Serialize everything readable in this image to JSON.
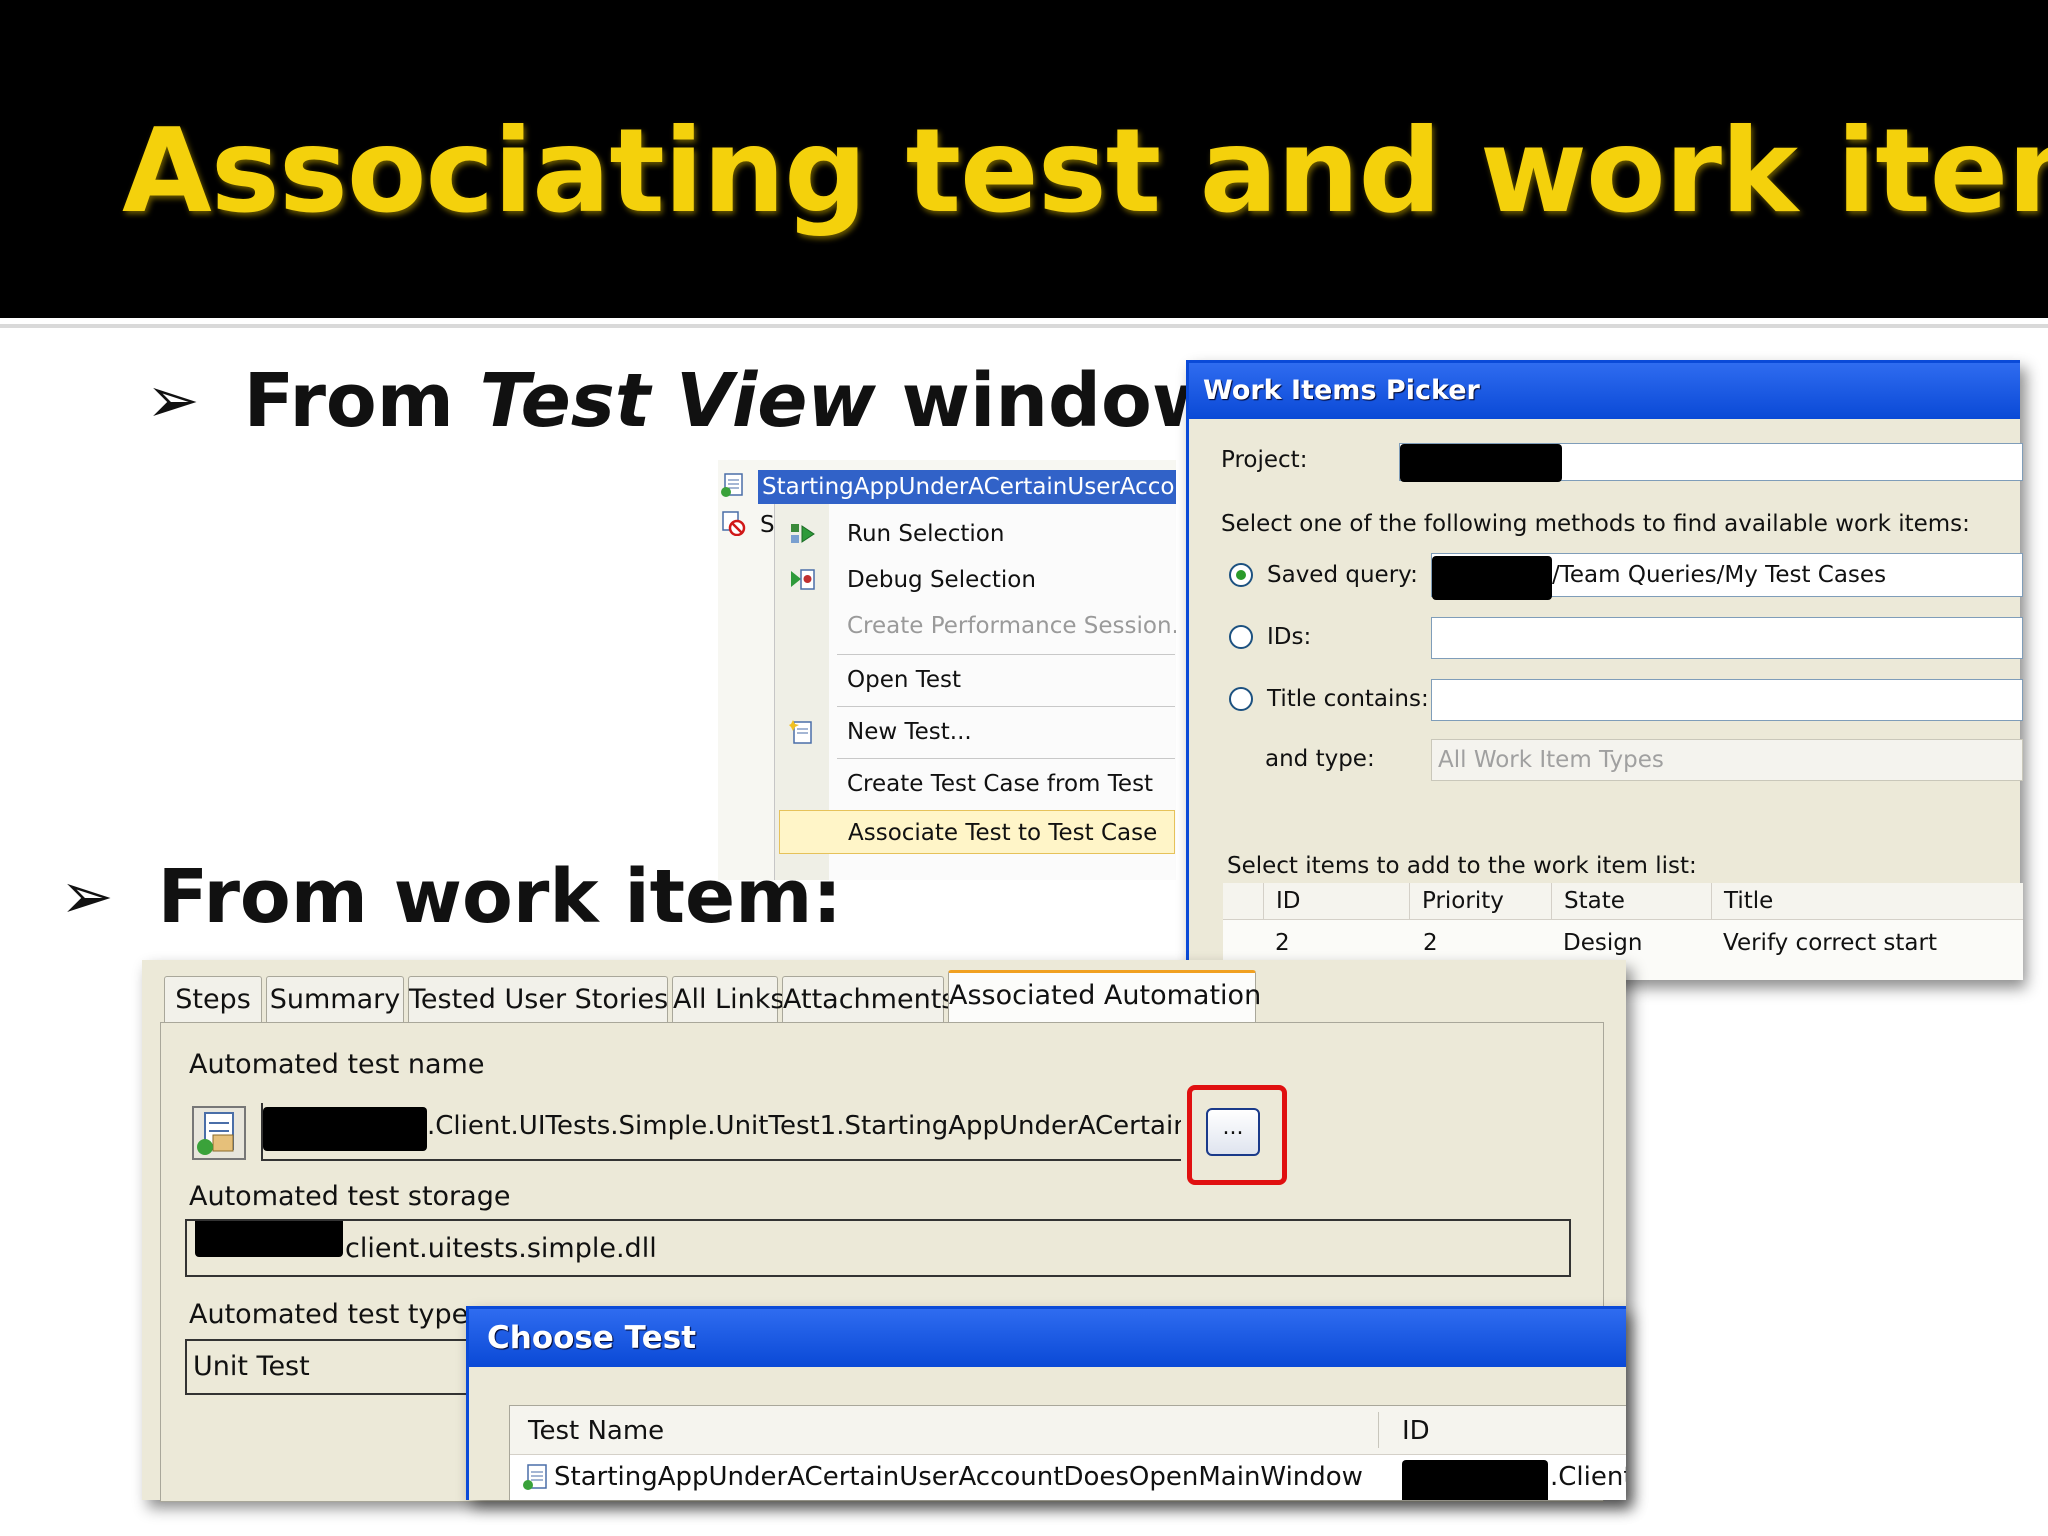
{
  "slide": {
    "title": "Associating test and work item",
    "bullet1": {
      "prefix": "From ",
      "italic": "Test View",
      "suffix": " window:"
    },
    "bullet2": "From work item:",
    "bullet_glyph": "➢"
  },
  "context_menu": {
    "selected_row_text": "StartingAppUnderACertainUserAccountD",
    "second_row_text": "S",
    "items": [
      {
        "label": "Run Selection",
        "icon": "run-icon",
        "enabled": true
      },
      {
        "label": "Debug Selection",
        "icon": "debug-icon",
        "enabled": true
      },
      {
        "label": "Create Performance Session...",
        "icon": "",
        "enabled": false
      },
      {
        "label": "Open Test",
        "icon": "",
        "enabled": true
      },
      {
        "label": "New Test...",
        "icon": "new-test-icon",
        "enabled": true
      },
      {
        "label": "Create Test Case from Test",
        "icon": "",
        "enabled": true
      },
      {
        "label": "Associate Test to Test Case",
        "icon": "",
        "enabled": true,
        "highlighted": true
      }
    ]
  },
  "work_items_picker": {
    "title": "Work Items Picker",
    "project_label": "Project:",
    "instructions": "Select one of the following methods to find available work items:",
    "saved_query_label": "Saved query:",
    "saved_query_value": "/Team Queries/My Test Cases",
    "ids_label": "IDs:",
    "title_contains_label": "Title contains:",
    "and_type_label": "and type:",
    "type_value": "All Work Item Types",
    "list_label": "Select items to add to the work item list:",
    "columns": [
      "ID",
      "Priority",
      "State",
      "Title"
    ],
    "rows": [
      {
        "id": "2",
        "priority": "2",
        "state": "Design",
        "title": "Verify correct start"
      }
    ]
  },
  "work_item_form": {
    "tabs": [
      "Steps",
      "Summary",
      "Tested User Stories",
      "All Links",
      "Attachments",
      "Associated Automation"
    ],
    "active_tab": "Associated Automation",
    "name_label": "Automated test name",
    "name_value": ".Client.UITests.Simple.UnitTest1.StartingAppUnderACertainUserAccountDoesOpenMain",
    "browse_label": "...",
    "storage_label": "Automated test storage",
    "storage_value": "client.uitests.simple.dll",
    "type_label": "Automated test type",
    "type_value": "Unit Test"
  },
  "choose_test": {
    "title": "Choose Test",
    "columns": [
      "Test Name",
      "ID"
    ],
    "row_name": "StartingAppUnderACertainUserAccountDoesOpenMainWindow",
    "row_id": ".Client"
  },
  "colors": {
    "title_yellow": "#f4d10c",
    "xp_blue": "#0a4ad8",
    "highlight_red": "#e01010"
  }
}
